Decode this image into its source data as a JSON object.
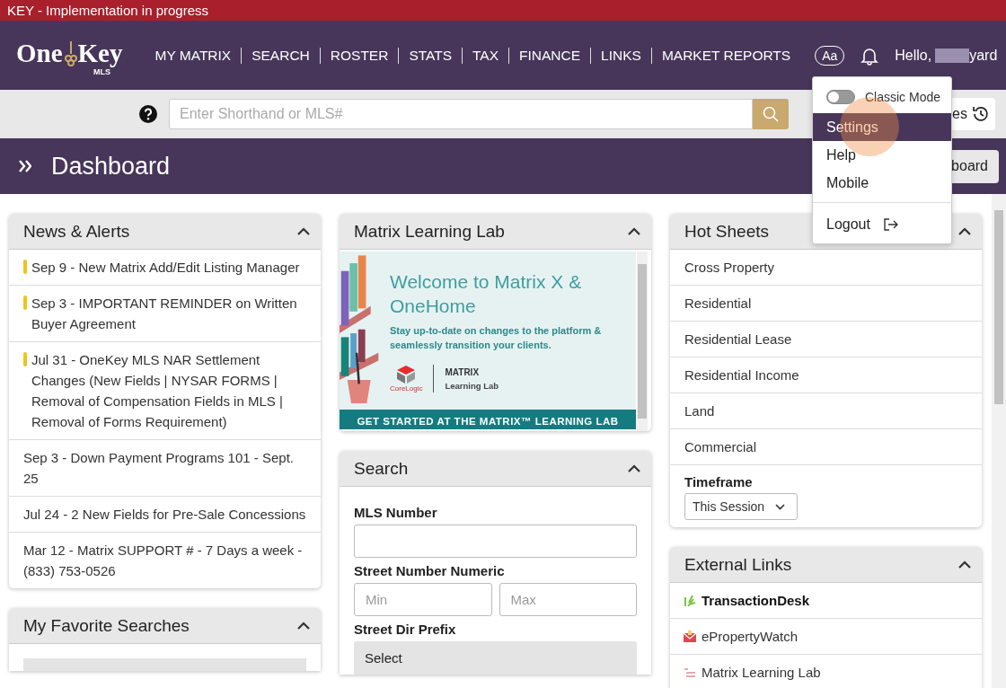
{
  "banner": {
    "text": "KEY - Implementation in progress"
  },
  "logo": {
    "word_1": "One",
    "word_2": "Key",
    "sub": "MLS"
  },
  "nav": {
    "items": [
      {
        "label": "MY MATRIX"
      },
      {
        "label": "SEARCH"
      },
      {
        "label": "ROSTER"
      },
      {
        "label": "STATS"
      },
      {
        "label": "TAX"
      },
      {
        "label": "FINANCE"
      },
      {
        "label": "LINKS"
      },
      {
        "label": "MARKET REPORTS"
      }
    ],
    "font_button": "Aa",
    "greeting": "Hello,",
    "user_name_visible": "yard"
  },
  "quick_search": {
    "placeholder": "Enter Shorthand or MLS#",
    "history_button": "es"
  },
  "page_header": {
    "title": "Dashboard",
    "button": "board"
  },
  "user_menu": {
    "classic_mode": {
      "label": "Classic Mode",
      "on": false
    },
    "items": [
      {
        "label": "Settings",
        "selected": true,
        "kind": "plain"
      },
      {
        "label": "Help",
        "selected": false,
        "kind": "plain"
      },
      {
        "label": "Mobile",
        "selected": false,
        "kind": "plain"
      },
      {
        "label": "Logout",
        "selected": false,
        "kind": "logout"
      }
    ]
  },
  "news": {
    "title": "News & Alerts",
    "items": [
      {
        "text": "Sep 9 - New Matrix Add/Edit Listing Manager",
        "important": true
      },
      {
        "text": "Sep 3 - IMPORTANT REMINDER on Written Buyer Agreement",
        "important": true
      },
      {
        "text": "Jul 31 - OneKey MLS NAR Settlement Changes (New Fields | NYSAR FORMS | Removal of Compensation Fields in MLS | Removal of Forms Requirement)",
        "important": true
      },
      {
        "text": "Sep 3 - Down Payment Programs 101 - Sept. 25",
        "important": false
      },
      {
        "text": "Jul 24 - 2 New Fields for Pre-Sale Concessions",
        "important": false
      },
      {
        "text": "Mar 12 - Matrix SUPPORT # - 7 Days a week - (833) 753-0526",
        "important": false
      }
    ]
  },
  "favorite_searches": {
    "title": "My Favorite Searches"
  },
  "learning_lab": {
    "title": "Matrix Learning Lab",
    "headline": "Welcome to Matrix X & OneHome",
    "subtext": "Stay up-to-date on changes to the platform & seamlessly transition your clients.",
    "brand": "CoreLogic",
    "product": "MATRIX",
    "product_sub": "Learning Lab",
    "cta": "GET STARTED AT THE MATRIX™ LEARNING LAB"
  },
  "search": {
    "title": "Search",
    "fields": [
      {
        "kind": "text",
        "label": "MLS Number"
      },
      {
        "kind": "range",
        "label": "Street Number Numeric",
        "min_placeholder": "Min",
        "max_placeholder": "Max"
      },
      {
        "kind": "select",
        "label": "Street Dir Prefix",
        "value": "Select"
      }
    ]
  },
  "hot_sheets": {
    "title": "Hot Sheets",
    "items": [
      {
        "label": "Cross Property"
      },
      {
        "label": "Residential"
      },
      {
        "label": "Residential Lease"
      },
      {
        "label": "Residential Income"
      },
      {
        "label": "Land"
      },
      {
        "label": "Commercial"
      }
    ],
    "timeframe_label": "Timeframe",
    "timeframe_value": "This Session"
  },
  "external_links": {
    "title": "External Links",
    "items": [
      {
        "label": "TransactionDesk",
        "kind": "leaf",
        "bold": true
      },
      {
        "label": "ePropertyWatch",
        "kind": "mail",
        "bold": false
      },
      {
        "label": "Matrix Learning Lab",
        "kind": "list",
        "bold": false
      }
    ]
  }
}
